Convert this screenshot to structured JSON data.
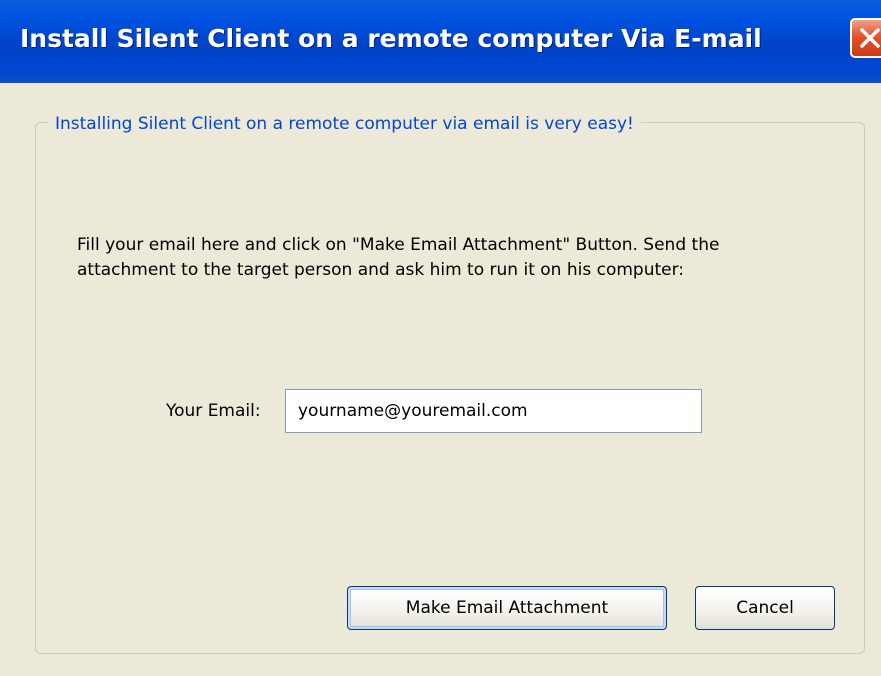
{
  "window": {
    "title": "Install Silent Client on a remote computer Via E-mail",
    "close_icon": "close-icon"
  },
  "group": {
    "legend": "Installing Silent Client on a remote computer via email is very easy!"
  },
  "instructions": "Fill your email here and click on \"Make Email Attachment\" Button. Send the attachment to the target person and ask him to run it on his computer:",
  "email": {
    "label": "Your Email:",
    "value": "yourname@youremail.com"
  },
  "buttons": {
    "make_attachment": "Make Email Attachment",
    "cancel": "Cancel"
  },
  "colors": {
    "titlebar": "#0054E3",
    "legend_text": "#0046D5",
    "dialog_bg": "#ECE9D8",
    "close_button": "#E4522E"
  }
}
